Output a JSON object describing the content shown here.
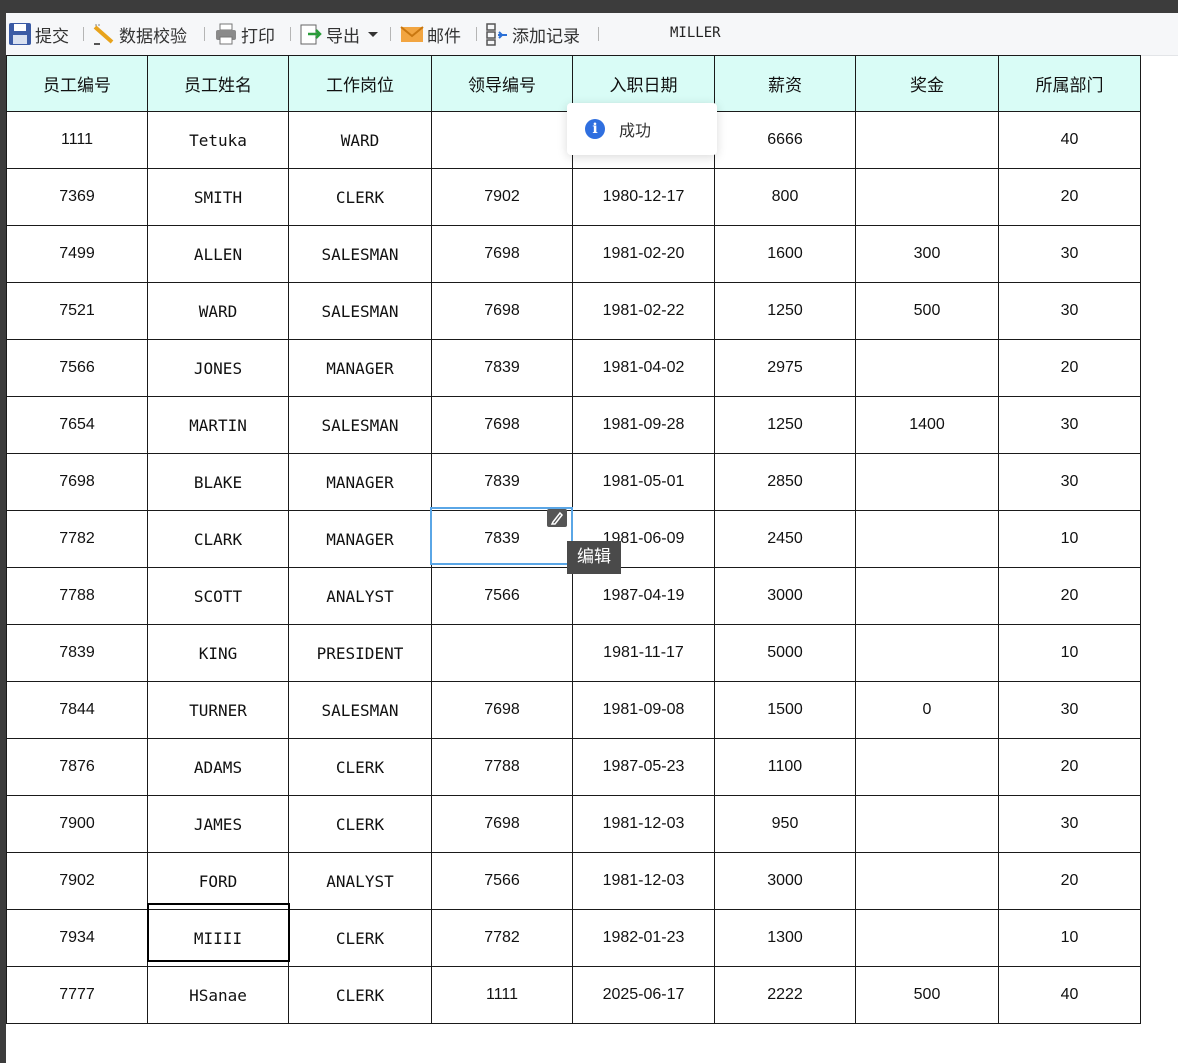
{
  "toolbar": {
    "submit": "提交",
    "validate": "数据校验",
    "print": "打印",
    "export": "导出",
    "mail": "邮件",
    "add_record": "添加记录",
    "preview_text": "MILLER"
  },
  "table": {
    "headers": [
      "员工编号",
      "员工姓名",
      "工作岗位",
      "领导编号",
      "入职日期",
      "薪资",
      "奖金",
      "所属部门"
    ],
    "rows": [
      [
        "1111",
        "Tetuka",
        "WARD",
        "",
        "",
        "6666",
        "",
        "40"
      ],
      [
        "7369",
        "SMITH",
        "CLERK",
        "7902",
        "1980-12-17",
        "800",
        "",
        "20"
      ],
      [
        "7499",
        "ALLEN",
        "SALESMAN",
        "7698",
        "1981-02-20",
        "1600",
        "300",
        "30"
      ],
      [
        "7521",
        "WARD",
        "SALESMAN",
        "7698",
        "1981-02-22",
        "1250",
        "500",
        "30"
      ],
      [
        "7566",
        "JONES",
        "MANAGER",
        "7839",
        "1981-04-02",
        "2975",
        "",
        "20"
      ],
      [
        "7654",
        "MARTIN",
        "SALESMAN",
        "7698",
        "1981-09-28",
        "1250",
        "1400",
        "30"
      ],
      [
        "7698",
        "BLAKE",
        "MANAGER",
        "7839",
        "1981-05-01",
        "2850",
        "",
        "30"
      ],
      [
        "7782",
        "CLARK",
        "MANAGER",
        "7839",
        "1981-06-09",
        "2450",
        "",
        "10"
      ],
      [
        "7788",
        "SCOTT",
        "ANALYST",
        "7566",
        "1987-04-19",
        "3000",
        "",
        "20"
      ],
      [
        "7839",
        "KING",
        "PRESIDENT",
        "",
        "1981-11-17",
        "5000",
        "",
        "10"
      ],
      [
        "7844",
        "TURNER",
        "SALESMAN",
        "7698",
        "1981-09-08",
        "1500",
        "0",
        "30"
      ],
      [
        "7876",
        "ADAMS",
        "CLERK",
        "7788",
        "1987-05-23",
        "1100",
        "",
        "20"
      ],
      [
        "7900",
        "JAMES",
        "CLERK",
        "7698",
        "1981-12-03",
        "950",
        "",
        "30"
      ],
      [
        "7902",
        "FORD",
        "ANALYST",
        "7566",
        "1981-12-03",
        "3000",
        "",
        "20"
      ],
      [
        "7934",
        "MIIII",
        "CLERK",
        "7782",
        "1982-01-23",
        "1300",
        "",
        "10"
      ],
      [
        "7777",
        "HSanae",
        "CLERK",
        "1111",
        "2025-06-17",
        "2222",
        "500",
        "40"
      ]
    ]
  },
  "tooltip": "编辑",
  "toast": {
    "message": "成功",
    "icon": "info-icon",
    "icon_color": "#2f6fdf"
  },
  "colors": {
    "header_bg": "#d9fcf6",
    "editing_border": "#5aa6e6",
    "active_border": "#000000"
  }
}
